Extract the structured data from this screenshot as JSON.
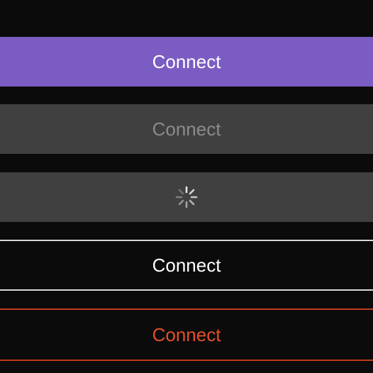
{
  "buttons": {
    "primary": {
      "label": "Connect",
      "state": "enabled",
      "color": "#7b5cc3"
    },
    "disabled": {
      "label": "Connect",
      "state": "disabled",
      "color": "#404040"
    },
    "loading": {
      "state": "loading",
      "icon": "spinner-icon"
    },
    "outline": {
      "label": "Connect",
      "state": "enabled",
      "color": "#d8d8d8"
    },
    "danger": {
      "label": "Connect",
      "state": "enabled",
      "color": "#e2502b"
    }
  }
}
